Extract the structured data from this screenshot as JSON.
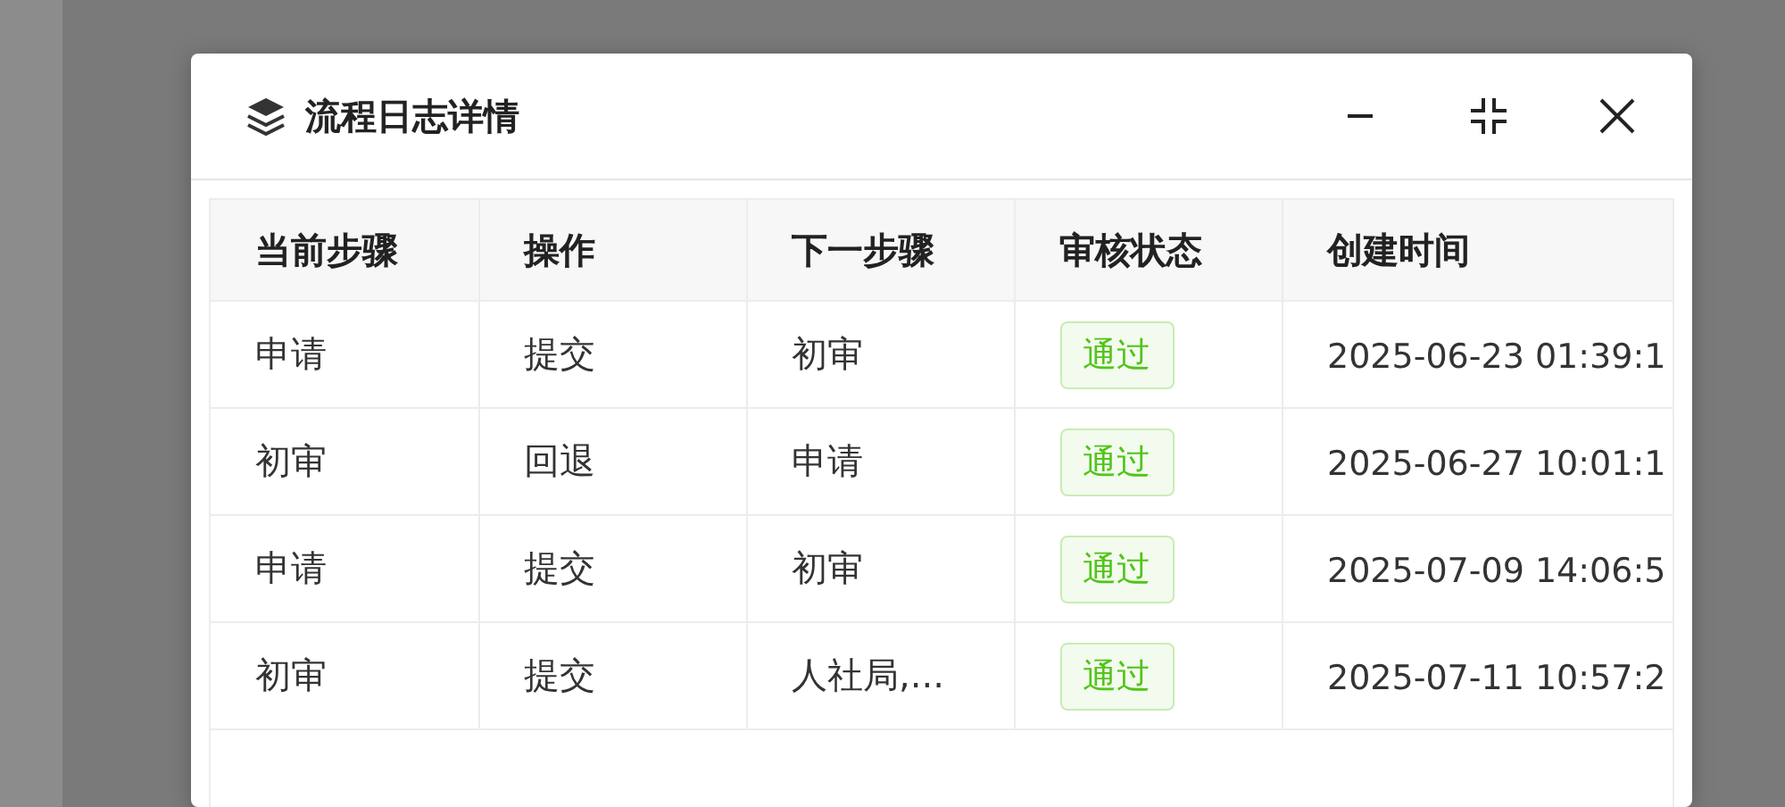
{
  "dialog": {
    "title": "流程日志详情"
  },
  "table": {
    "columns": [
      "当前步骤",
      "操作",
      "下一步骤",
      "审核状态",
      "创建时间"
    ],
    "rows": [
      {
        "step": "申请",
        "action": "提交",
        "next": "初审",
        "status": {
          "text": "通过",
          "kind": "success"
        },
        "time": "2025-06-23 01:39:1"
      },
      {
        "step": "初审",
        "action": "回退",
        "next": "申请",
        "status": {
          "text": "通过",
          "kind": "success"
        },
        "time": "2025-06-27 10:01:1"
      },
      {
        "step": "申请",
        "action": "提交",
        "next": "初审",
        "status": {
          "text": "通过",
          "kind": "success"
        },
        "time": "2025-07-09 14:06:5"
      },
      {
        "step": "初审",
        "action": "提交",
        "next": "人社局,...",
        "status": {
          "text": "通过",
          "kind": "success"
        },
        "time": "2025-07-11 10:57:2"
      }
    ]
  }
}
